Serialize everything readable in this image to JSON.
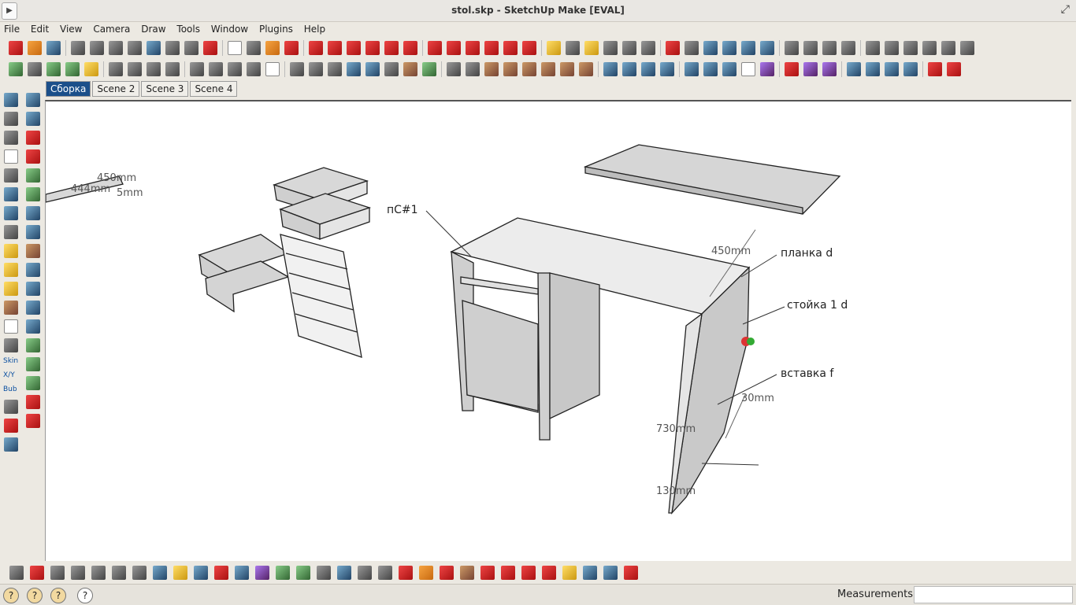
{
  "window": {
    "title": "stol.skp - SketchUp Make [EVAL]"
  },
  "menu": [
    "File",
    "Edit",
    "View",
    "Camera",
    "Draw",
    "Tools",
    "Window",
    "Plugins",
    "Help"
  ],
  "scenes": [
    {
      "label": "Сборка",
      "active": true
    },
    {
      "label": "Scene 2",
      "active": false
    },
    {
      "label": "Scene 3",
      "active": false
    },
    {
      "label": "Scene 4",
      "active": false
    }
  ],
  "model_labels": {
    "pc1": "пС#1",
    "planka": "планка d",
    "stoika": "стойка 1 d",
    "vstavka": "вставка f"
  },
  "dimensions": {
    "d450": "450mm",
    "d30": "30mm",
    "d730": "730mm",
    "d130": "130mm",
    "left_a": "450mm",
    "left_b": "5mm",
    "left_c": "444mm"
  },
  "left_tools": {
    "skin": "Skin",
    "xyz": "X/Y",
    "bub": "Bub"
  },
  "status": {
    "measurements_label": "Measurements",
    "measurements_value": ""
  }
}
